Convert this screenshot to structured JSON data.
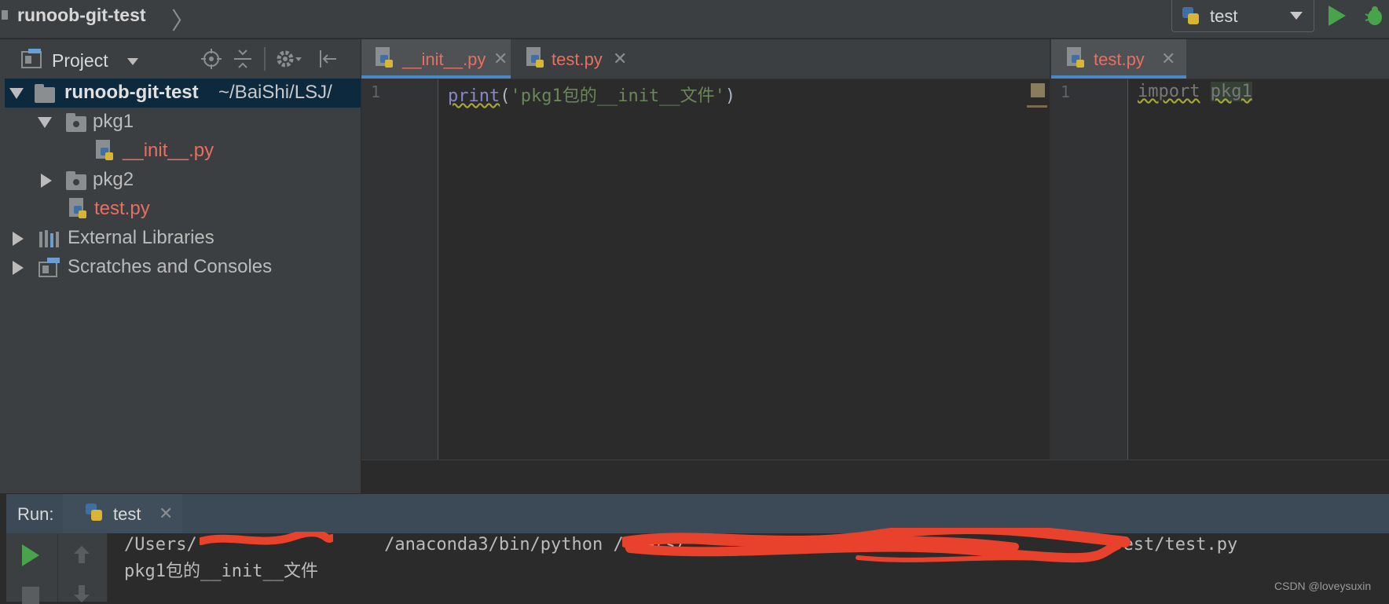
{
  "window": {
    "title": "runoob-git-test"
  },
  "toolbar": {
    "run_config": "test"
  },
  "project": {
    "header": "Project",
    "tree": [
      {
        "label": "runoob-git-test",
        "path": "~/BaiShi/LSJ/",
        "type": "root"
      },
      {
        "label": "pkg1",
        "type": "folder"
      },
      {
        "label": "__init__.py",
        "type": "file"
      },
      {
        "label": "pkg2",
        "type": "folder"
      },
      {
        "label": "test.py",
        "type": "file"
      },
      {
        "label": "External Libraries",
        "type": "library"
      },
      {
        "label": "Scratches and Consoles",
        "type": "scratch"
      }
    ]
  },
  "editor_left": {
    "tabs": [
      {
        "label": "__init__.py"
      },
      {
        "label": "test.py"
      }
    ],
    "line_no": "1",
    "code": {
      "fn": "print",
      "open": "(",
      "str": "'pkg1包的__init__文件'",
      "close": ")"
    }
  },
  "editor_right": {
    "tabs": [
      {
        "label": "test.py"
      }
    ],
    "line_no": "1",
    "code": {
      "kw": "import",
      "mod": "pkg1"
    }
  },
  "run": {
    "label": "Run:",
    "tab": "test",
    "output": [
      "/Users/                  /anaconda3/bin/python /Users/                                          est/test.py",
      "pkg1包的__init__文件"
    ]
  },
  "watermark": "CSDN @loveysuxin",
  "colors": {
    "accent": "#4a88c7",
    "modified_file": "#e76f62",
    "run_green": "#49a34a",
    "redaction": "#e8412c"
  }
}
